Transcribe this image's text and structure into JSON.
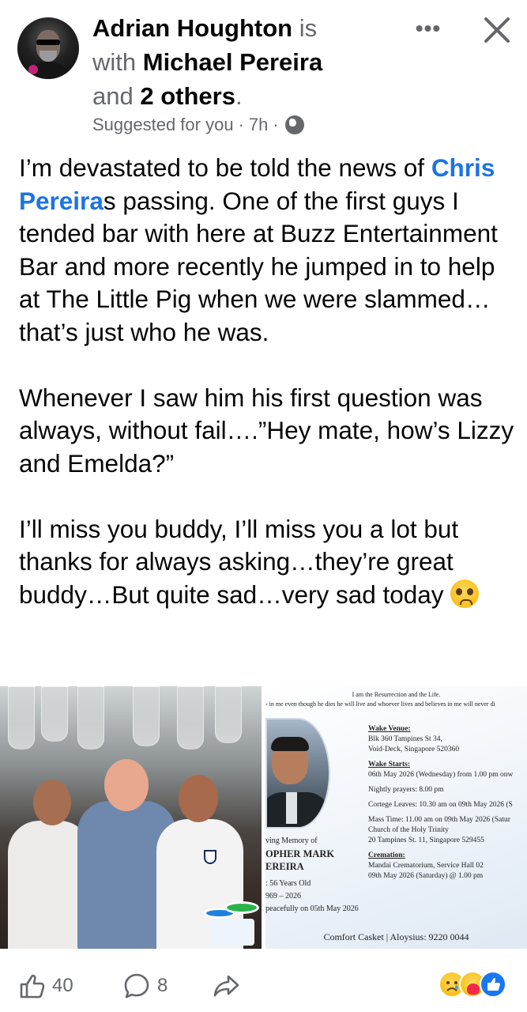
{
  "header": {
    "author": "Adrian Houghton",
    "is_text": " is",
    "with_text": "with ",
    "tagged": "Michael Pereira",
    "and_text": "and ",
    "others": "2 others",
    "period": ".",
    "suggested": "Suggested for you",
    "time": "7h",
    "separator": "·",
    "more_label": "•••"
  },
  "post": {
    "p1_mention": "Chris Pereira",
    "p1_before": "I’m devastated to be told the news of ",
    "p1_after": "s passing. One of the first guys I tended bar with here at Buzz Entertainment Bar and more recently he jumped in to help at The Little Pig when we were slammed…that’s just who he was.",
    "p2": "Whenever I saw him his first question was always, without fail….”Hey mate, how’s Lizzy and Emelda?”",
    "p3": "I’ll miss you buddy, I’ll miss you a lot but thanks for always asking…they’re great buddy…But quite sad…very sad today"
  },
  "notice": {
    "top_line": "I am the Resurrection and the Life.",
    "second_line": "› in me even though he dies he will live and whoever lives and believes in me will never di",
    "memory_line1": "ving Memory of",
    "memory_name1": "OPHER MARK",
    "memory_name2": "EREIRA",
    "age": ": 56 Years Old",
    "years": "969 – 2026",
    "passed": "peacefully on 05th May 2026",
    "wake_venue_h": "Wake Venue:",
    "wake_venue_1": "Blk 360 Tampines St 34,",
    "wake_venue_2": "Void-Deck, Singapore 520360",
    "wake_starts_h": "Wake Starts:",
    "wake_starts_1": "06th May 2026 (Wednesday) from 1.00 pm onw",
    "prayers": "Nightly prayers: 8.00 pm",
    "cortege": "Cortege Leaves: 10.30 am on 09th May 2026 (S",
    "mass": "Mass Time: 11.00 am on 09th May 2026 (Satur",
    "church": "Church of the Holy Trinity",
    "church_addr": "20 Tampines St. 11, Singapore 529455",
    "cremation_h": "Cremation:",
    "cremation_1": "Mandai Crematorium, Service Hall 02",
    "cremation_2": "09th May 2026 (Saturday) @ 1.00 pm",
    "footer": "Comfort Casket | Aloysius: 9220 0044"
  },
  "footer": {
    "likes": "40",
    "comments": "8"
  },
  "colors": {
    "mention": "#1b74e4",
    "secondary": "#65676b",
    "like_blue": "#1877f2"
  },
  "icons": [
    "avatar",
    "more-icon",
    "close-icon",
    "globe-icon",
    "like-icon",
    "comment-icon",
    "share-icon",
    "sad-reaction-icon",
    "care-reaction-icon",
    "like-reaction-icon"
  ]
}
